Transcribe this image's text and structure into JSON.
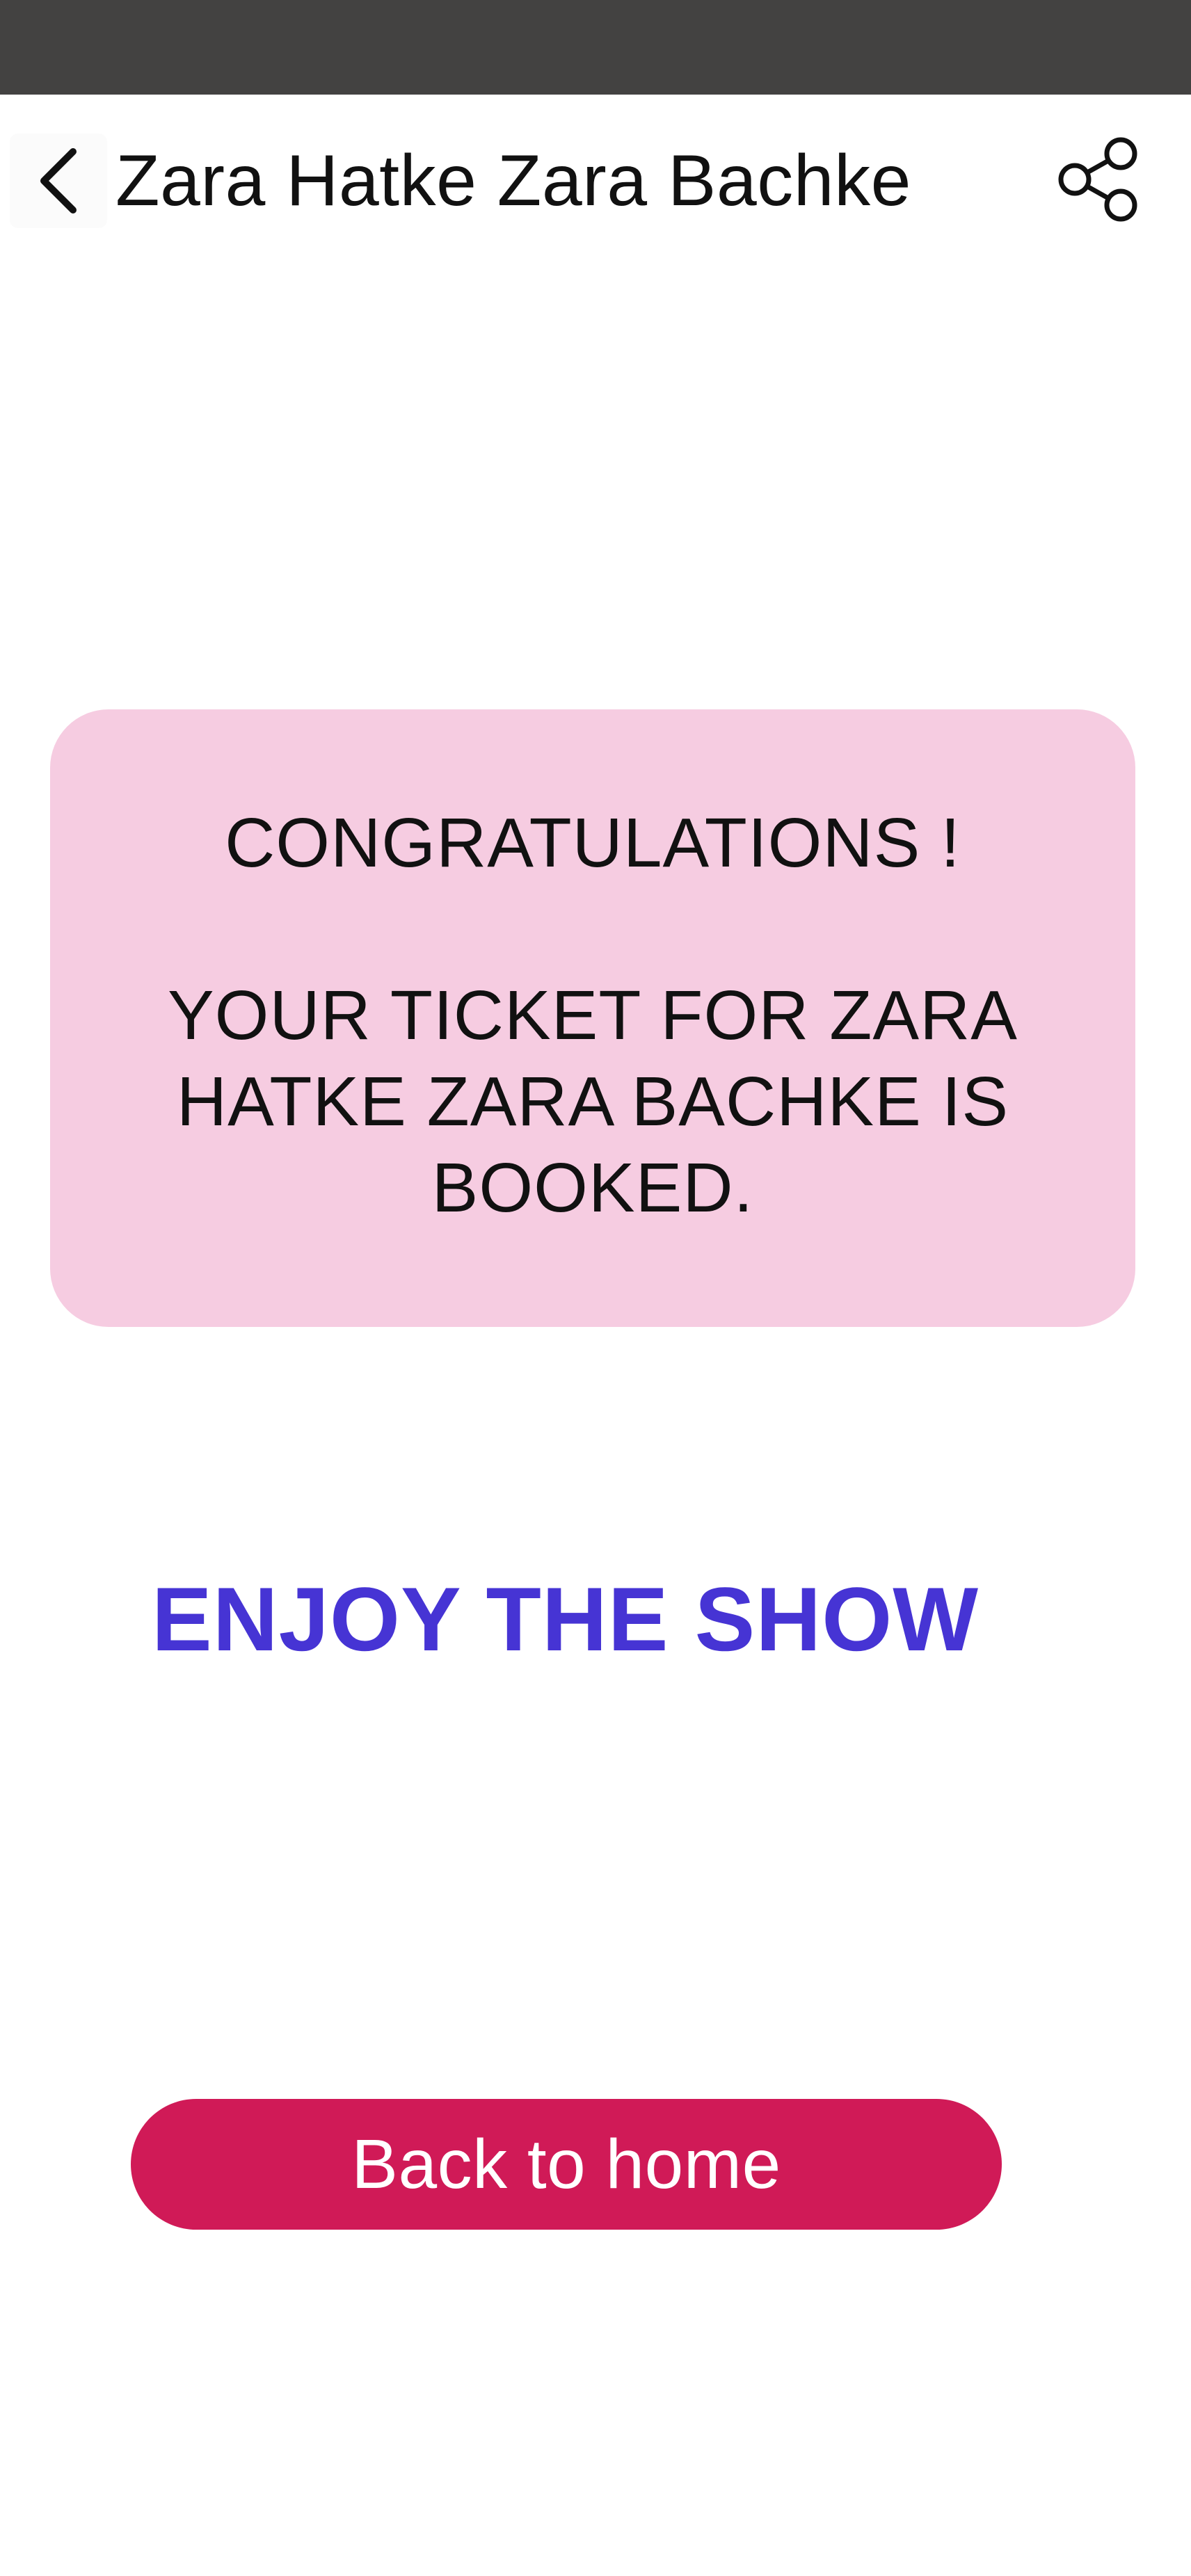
{
  "header": {
    "title": "Zara Hatke Zara Bachke",
    "back_icon": "chevron-left-icon",
    "share_icon": "share-icon"
  },
  "confirmation": {
    "headline": "CONGRATULATIONS !",
    "message": "YOUR TICKET FOR ZARA HATKE ZARA BACHKE IS BOOKED.",
    "card_color": "#f6cce1"
  },
  "enjoy": {
    "text": "ENJOY THE SHOW",
    "color": "#4634d4"
  },
  "actions": {
    "home_label": "Back to home",
    "home_color": "#d01a57"
  },
  "colors": {
    "status_bar": "#434241",
    "background": "#ffffff"
  }
}
